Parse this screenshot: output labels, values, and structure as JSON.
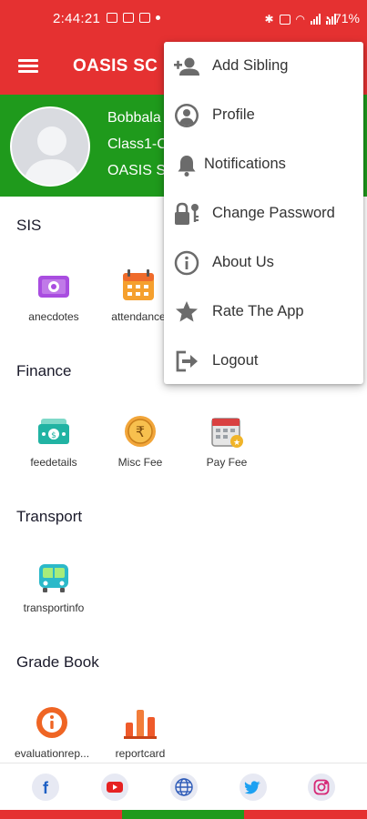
{
  "status_bar": {
    "time": "2:44:21",
    "battery": "71%"
  },
  "app_bar": {
    "title": "OASIS SC"
  },
  "profile": {
    "name": "Bobbala",
    "class_text": "Class1-C",
    "school": "OASIS S"
  },
  "sections": [
    {
      "title": "SIS",
      "tiles": [
        {
          "label": "anecdotes",
          "icon": "camera-icon"
        },
        {
          "label": "attendance",
          "icon": "calendar-icon"
        }
      ]
    },
    {
      "title": "Finance",
      "tiles": [
        {
          "label": "feedetails",
          "icon": "cash-icon"
        },
        {
          "label": "Misc Fee",
          "icon": "rupee-coin-icon"
        },
        {
          "label": "Pay Fee",
          "icon": "payment-calendar-icon"
        }
      ]
    },
    {
      "title": "Transport",
      "tiles": [
        {
          "label": "transportinfo",
          "icon": "bus-icon"
        }
      ]
    },
    {
      "title": "Grade Book",
      "tiles": [
        {
          "label": "evaluationrep...",
          "icon": "info-badge-icon"
        },
        {
          "label": "reportcard",
          "icon": "bar-chart-icon"
        }
      ]
    }
  ],
  "menu": {
    "items": [
      {
        "label": "Add Sibling",
        "icon": "add-person-icon"
      },
      {
        "label": "Profile",
        "icon": "account-circle-icon"
      },
      {
        "label": "Notifications",
        "icon": "bell-icon"
      },
      {
        "label": "Change Password",
        "icon": "lock-key-icon"
      },
      {
        "label": "About Us",
        "icon": "info-icon"
      },
      {
        "label": "Rate The App",
        "icon": "star-icon"
      },
      {
        "label": "Logout",
        "icon": "logout-icon"
      }
    ]
  },
  "footer": {
    "social": [
      "facebook-icon",
      "youtube-icon",
      "globe-icon",
      "twitter-icon",
      "instagram-icon"
    ]
  },
  "colors": {
    "primary_red": "#e53131",
    "profile_green": "#1f9a1c"
  }
}
